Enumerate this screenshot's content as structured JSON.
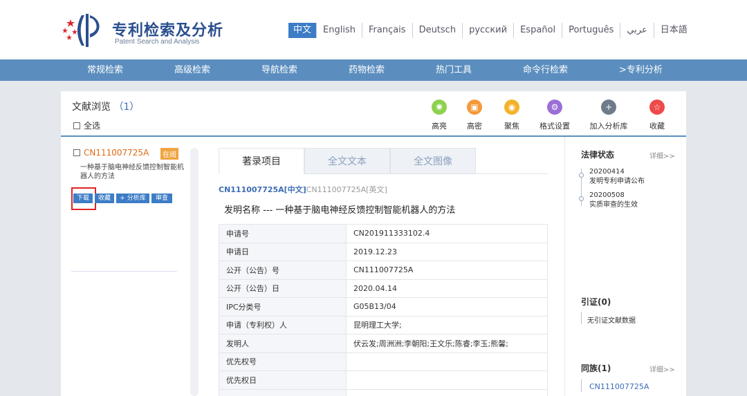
{
  "header": {
    "logo_title": "专利检索及分析",
    "logo_subtitle": "Patent Search and Analysis",
    "languages": [
      "中文",
      "English",
      "Français",
      "Deutsch",
      "русский",
      "Español",
      "Português",
      "عربي",
      "日本語"
    ]
  },
  "nav": {
    "items": [
      "常规检索",
      "高级检索",
      "导航检索",
      "药物检索",
      "热门工具",
      "命令行检索",
      ">专利分析"
    ]
  },
  "toolbar": {
    "title": "文献浏览",
    "count": "（1）",
    "select_all": "全选",
    "tools": [
      {
        "label": "高亮",
        "icon": "highlight-icon",
        "color": "#8fd14f"
      },
      {
        "label": "高密",
        "icon": "dense-icon",
        "color": "#f39a3a"
      },
      {
        "label": "聚焦",
        "icon": "focus-icon",
        "color": "#f2b32b"
      },
      {
        "label": "格式设置",
        "icon": "format-settings-icon",
        "color": "#9b6fd6"
      },
      {
        "label": "加入分析库",
        "icon": "add-library-icon",
        "color": "#6e7b8a"
      },
      {
        "label": "收藏",
        "icon": "favorite-icon",
        "color": "#ef4a4a"
      }
    ]
  },
  "result": {
    "id": "CN111007725A",
    "badge": "在阅",
    "title": "一种基于脑电神经反馈控制智能机器人的方法",
    "actions": [
      "下载",
      "收藏",
      "+ 分析库",
      "审查"
    ]
  },
  "tabs": [
    "著录项目",
    "全文文本",
    "全文图像"
  ],
  "doc_links": {
    "cn": "CN111007725A[中文]",
    "en": "CN111007725A[英文]"
  },
  "invention_name": "发明名称 --- 一种基于脑电神经反馈控制智能机器人的方法",
  "biblio": [
    {
      "key": "申请号",
      "value": "CN201911333102.4"
    },
    {
      "key": "申请日",
      "value": "2019.12.23"
    },
    {
      "key": "公开（公告）号",
      "value": "CN111007725A"
    },
    {
      "key": "公开（公告）日",
      "value": "2020.04.14"
    },
    {
      "key": "IPC分类号",
      "value": "G05B13/04"
    },
    {
      "key": "申请（专利权）人",
      "value": "昆明理工大学;"
    },
    {
      "key": "发明人",
      "value": "伏云发;周洲洲;李朝阳;王文乐;陈睿;李玉;熊馨;"
    },
    {
      "key": "优先权号",
      "value": ""
    },
    {
      "key": "优先权日",
      "value": ""
    },
    {
      "key": "",
      "value": ""
    }
  ],
  "sidebar": {
    "legal_title": "法律状态",
    "legal_more": "详细>>",
    "legal_events": [
      {
        "date": "20200414",
        "desc": "发明专利申请公布"
      },
      {
        "date": "20200508",
        "desc": "实质审查的生效"
      }
    ],
    "citation_title": "引证(0)",
    "citation_value": "无引证文献数据",
    "family_title": "同族(1)",
    "family_more": "详细>>",
    "family_value": "CN111007725A"
  }
}
